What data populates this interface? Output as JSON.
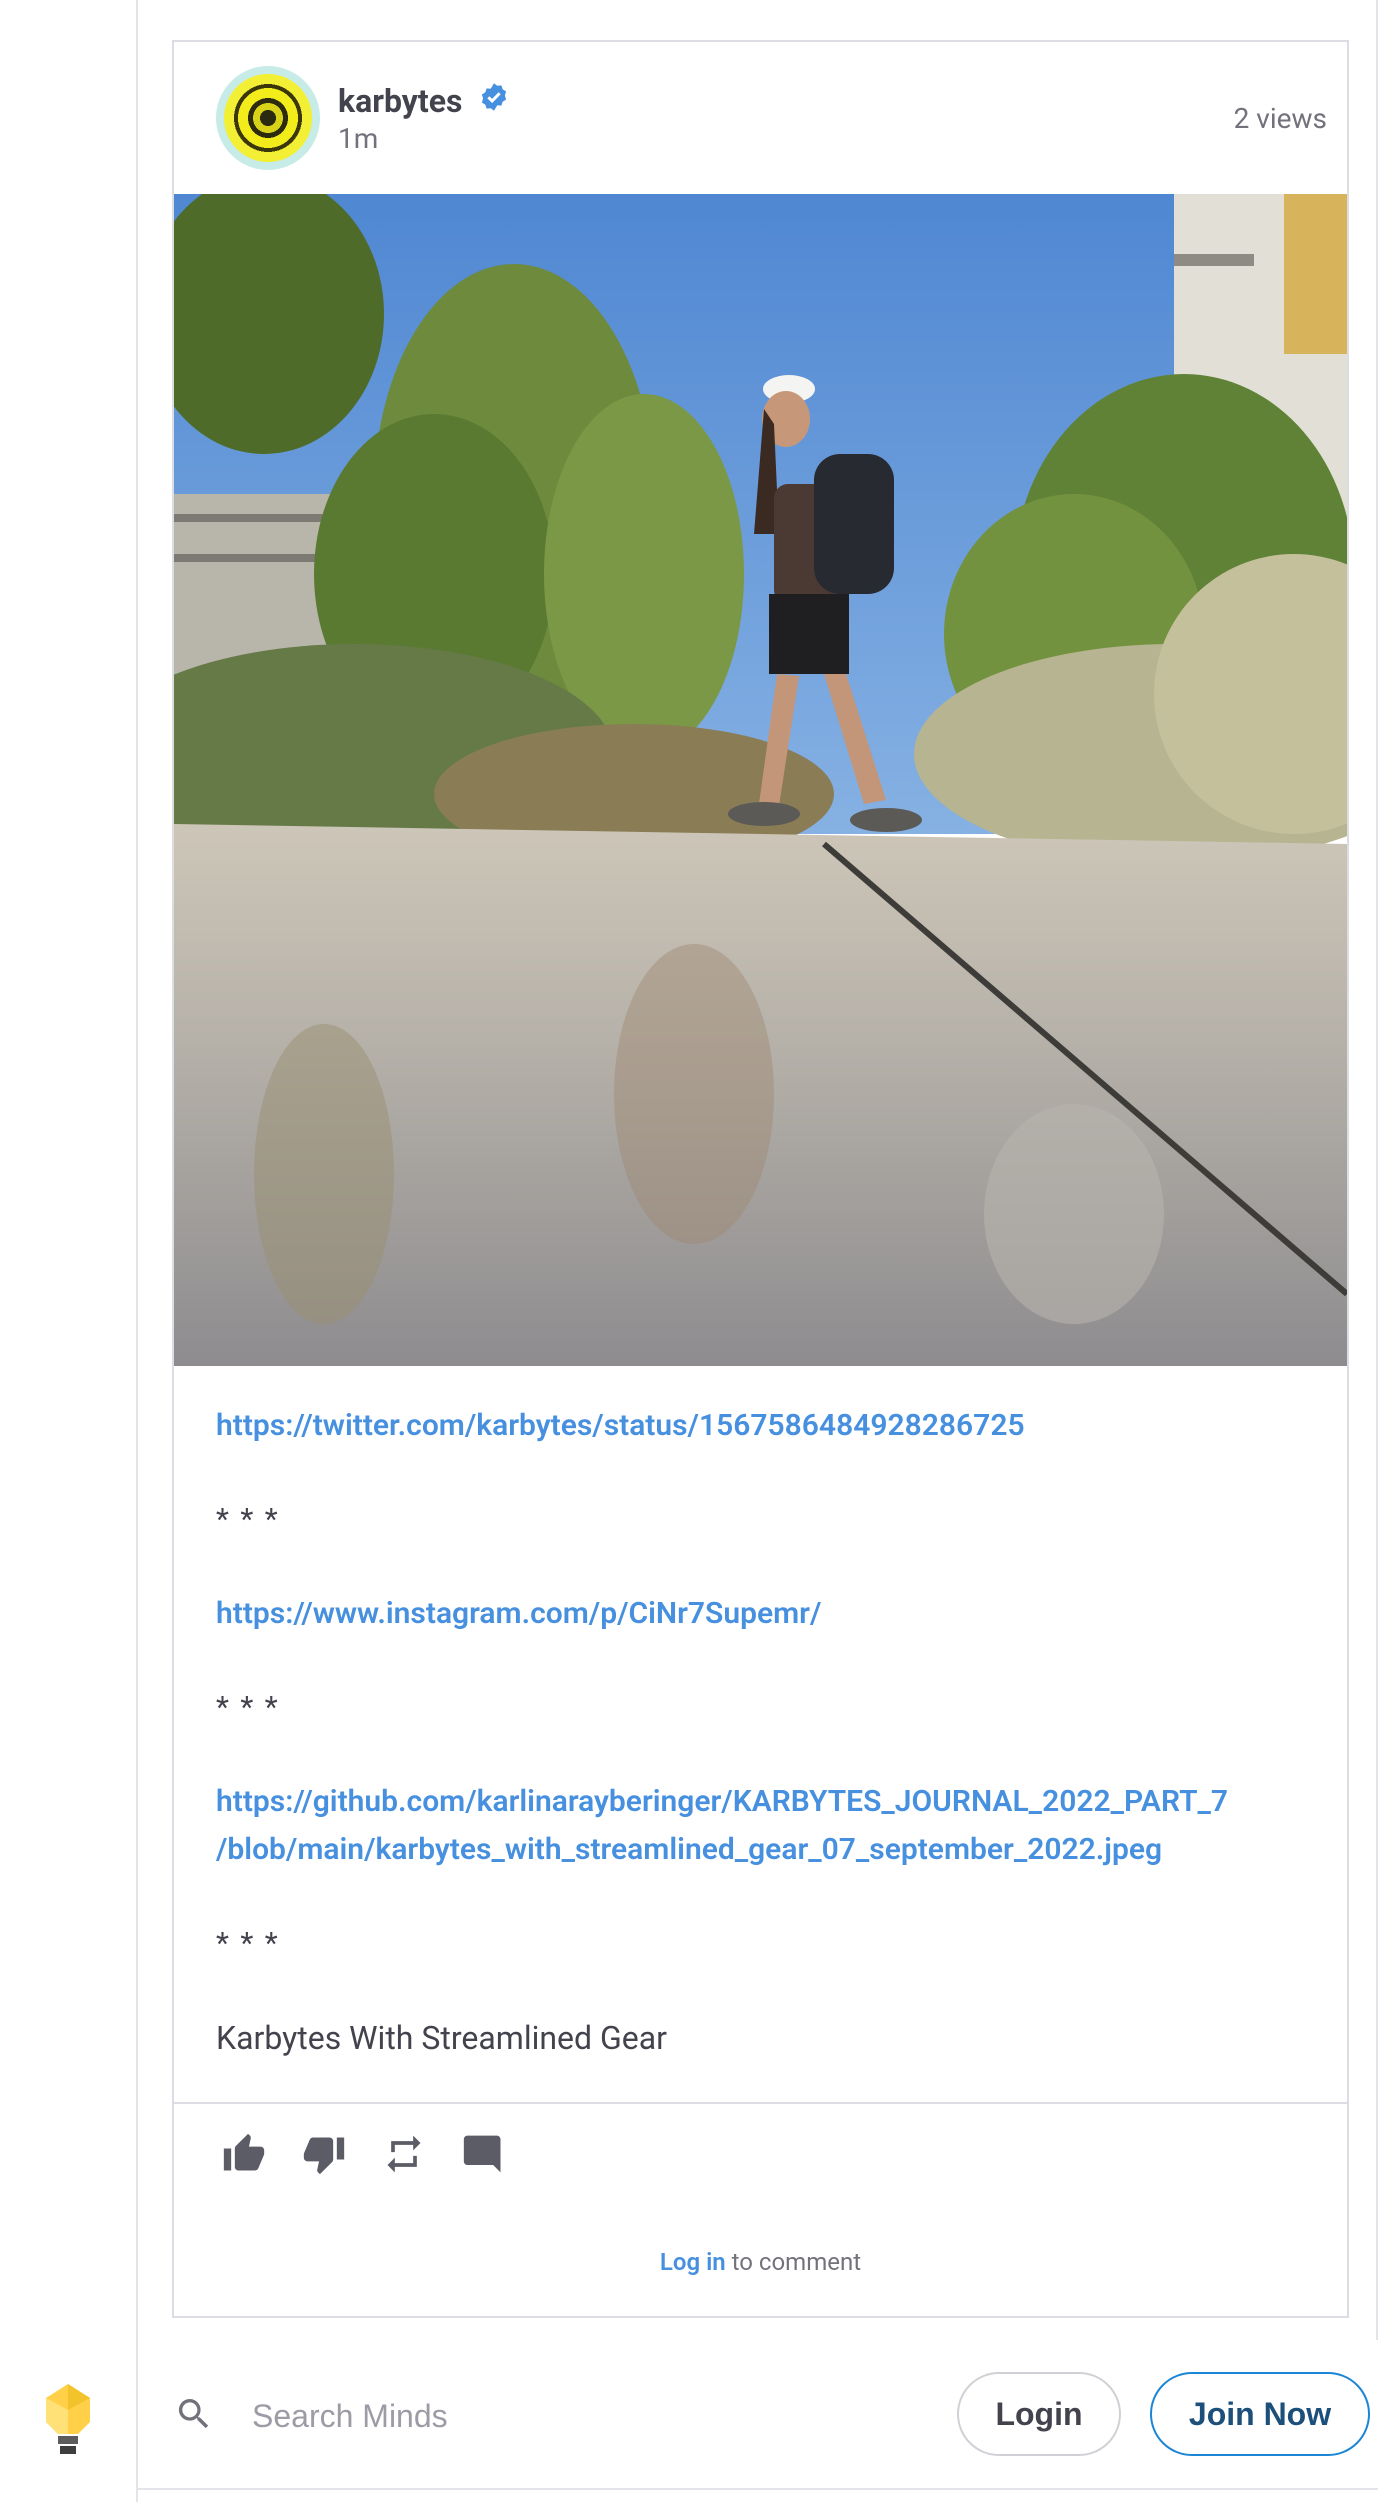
{
  "post": {
    "author": "karbytes",
    "time": "1m",
    "views": "2 views",
    "links": [
      "https://twitter.com/karbytes/status/1567586484928286725",
      "https://www.instagram.com/p/CiNr7Supemr/",
      "https://github.com/karlinarayberinger/KARBYTES_JOURNAL_2022_PART_7",
      "/blob/main/karbytes_with_streamlined_gear_07_september_2022.jpeg"
    ],
    "separator": "* * *",
    "caption": "Karbytes With Streamlined Gear",
    "comment_login": "Log in",
    "comment_suffix": " to comment"
  },
  "actions": [
    "thumbs-up-icon",
    "thumbs-down-icon",
    "remind-icon",
    "comment-icon"
  ],
  "footer": {
    "search_placeholder": "Search Minds",
    "login_label": "Login",
    "join_label": "Join Now"
  },
  "colors": {
    "link": "#4690df",
    "accent": "#1b85d6",
    "text": "#43434d"
  }
}
